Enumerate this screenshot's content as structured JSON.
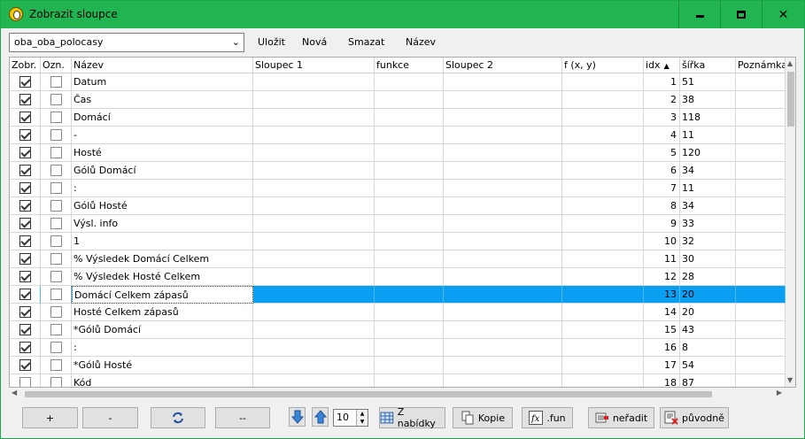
{
  "window": {
    "title": "Zobrazit sloupce"
  },
  "toolbar": {
    "preset_value": "oba_oba_polocasy",
    "save": "Uložit",
    "new": "Nová",
    "delete": "Smazat",
    "name": "Název"
  },
  "columns": [
    "Zobr.",
    "Ozn.",
    "Název",
    "Sloupec 1",
    "funkce",
    "Sloupec 2",
    "f (x, y)",
    "idx",
    "šířka",
    "Poznámka"
  ],
  "rows": [
    {
      "show": true,
      "mark": false,
      "name": "Datum",
      "idx": "1",
      "width": "51"
    },
    {
      "show": true,
      "mark": false,
      "name": "Čas",
      "idx": "2",
      "width": "38"
    },
    {
      "show": true,
      "mark": false,
      "name": "Domácí",
      "idx": "3",
      "width": "118"
    },
    {
      "show": true,
      "mark": false,
      "name": "-",
      "idx": "4",
      "width": "11"
    },
    {
      "show": true,
      "mark": false,
      "name": "Hosté",
      "idx": "5",
      "width": "120"
    },
    {
      "show": true,
      "mark": false,
      "name": "Gólů Domácí",
      "idx": "6",
      "width": "34"
    },
    {
      "show": true,
      "mark": false,
      "name": ":",
      "idx": "7",
      "width": "11"
    },
    {
      "show": true,
      "mark": false,
      "name": "Gólů Hosté",
      "idx": "8",
      "width": "34"
    },
    {
      "show": true,
      "mark": false,
      "name": "Výsl. info",
      "idx": "9",
      "width": "33"
    },
    {
      "show": true,
      "mark": false,
      "name": "1",
      "idx": "10",
      "width": "32"
    },
    {
      "show": true,
      "mark": false,
      "name": "% Výsledek Domácí Celkem",
      "idx": "11",
      "width": "30"
    },
    {
      "show": true,
      "mark": false,
      "name": "% Výsledek Hosté Celkem",
      "idx": "12",
      "width": "28"
    },
    {
      "show": true,
      "mark": false,
      "name": "Domácí Celkem zápasů",
      "idx": "13",
      "width": "20",
      "selected": true
    },
    {
      "show": true,
      "mark": false,
      "name": "Hosté Celkem zápasů",
      "idx": "14",
      "width": "20"
    },
    {
      "show": true,
      "mark": false,
      "name": "*Gólů Domácí",
      "idx": "15",
      "width": "43"
    },
    {
      "show": true,
      "mark": false,
      "name": ":",
      "idx": "16",
      "width": "8"
    },
    {
      "show": true,
      "mark": false,
      "name": "*Gólů Hosté",
      "idx": "17",
      "width": "54"
    },
    {
      "show": false,
      "mark": false,
      "name": "Kód",
      "idx": "18",
      "width": "87"
    }
  ],
  "bottom": {
    "add": "+",
    "remove": "-",
    "clear": "--",
    "step_value": "10",
    "from_menu": "Z nabídky",
    "copy": "Kopie",
    "fun": ".fun",
    "unsort": "neřadit",
    "original": "původně"
  },
  "icons": {
    "title": "app-logo-icon",
    "refresh": "refresh-icon",
    "down": "arrow-down-icon",
    "up": "arrow-up-icon"
  }
}
